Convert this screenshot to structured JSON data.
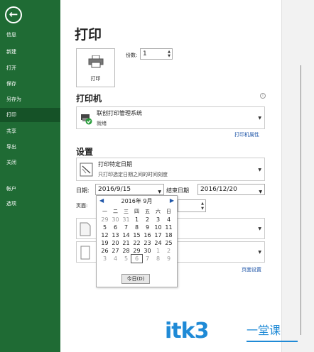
{
  "sidebar": {
    "back": "←",
    "items": [
      {
        "label": "信息"
      },
      {
        "label": "新建"
      },
      {
        "label": "打开"
      },
      {
        "label": "保存"
      },
      {
        "label": "另存为"
      },
      {
        "label": "打印"
      },
      {
        "label": "共享"
      },
      {
        "label": "导出"
      },
      {
        "label": "关闭"
      },
      {
        "label": "帐户"
      },
      {
        "label": "选项"
      }
    ]
  },
  "main": {
    "title": "打印",
    "print_button_label": "打印",
    "copies_label": "份数:",
    "copies_value": "1",
    "printer_heading": "打印机",
    "printer_name": "联创打印管理系统",
    "printer_status": "就绪",
    "printer_properties_link": "打印机属性",
    "settings_heading": "设置",
    "print_range_main": "打印特定日期",
    "print_range_sub": "只打印选定日期之间的时间刻度",
    "start_date_label": "日期:",
    "start_date_value": "2016/9/15",
    "end_date_label": "结束日期",
    "end_date_value": "2016/12/20",
    "pages_label": "页面:",
    "page_setup_link": "页面设置"
  },
  "calendar": {
    "month_title": "2016年 9月",
    "weekdays": [
      "一",
      "二",
      "三",
      "四",
      "五",
      "六",
      "日"
    ],
    "weeks": [
      [
        "29",
        "30",
        "31",
        "1",
        "2",
        "3",
        "4"
      ],
      [
        "5",
        "6",
        "7",
        "8",
        "9",
        "10",
        "11"
      ],
      [
        "12",
        "13",
        "14",
        "15",
        "16",
        "17",
        "18"
      ],
      [
        "19",
        "20",
        "21",
        "22",
        "23",
        "24",
        "25"
      ],
      [
        "26",
        "27",
        "28",
        "29",
        "30",
        "1",
        "2"
      ],
      [
        "3",
        "4",
        "5",
        "6",
        "7",
        "8",
        "9"
      ]
    ],
    "today_button": "今日(D)"
  },
  "watermark": {
    "text": "itk3",
    "sub": "一堂课",
    "color": "#1f8ad6"
  }
}
